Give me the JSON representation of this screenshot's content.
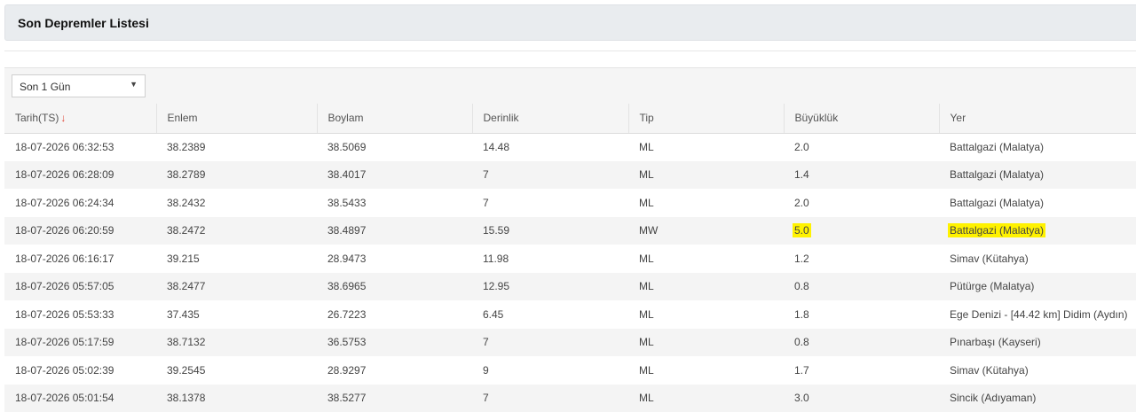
{
  "page": {
    "title": "Son Depremler Listesi"
  },
  "filter": {
    "selected": "Son 1 Gün",
    "arrow": "▼"
  },
  "table": {
    "columns": [
      "Tarih(TS)",
      "Enlem",
      "Boylam",
      "Derinlik",
      "Tip",
      "Büyüklük",
      "Yer"
    ],
    "sort_arrow": "↓",
    "highlight_color": "#fff200",
    "rows": [
      {
        "date": "18-07-2026 06:32:53",
        "lat": "38.2389",
        "lon": "38.5069",
        "depth": "14.48",
        "type": "ML",
        "mag": "2.0",
        "place": "Battalgazi (Malatya)",
        "highlighted": false
      },
      {
        "date": "18-07-2026 06:28:09",
        "lat": "38.2789",
        "lon": "38.4017",
        "depth": "7",
        "type": "ML",
        "mag": "1.4",
        "place": "Battalgazi (Malatya)",
        "highlighted": false
      },
      {
        "date": "18-07-2026 06:24:34",
        "lat": "38.2432",
        "lon": "38.5433",
        "depth": "7",
        "type": "ML",
        "mag": "2.0",
        "place": "Battalgazi (Malatya)",
        "highlighted": false
      },
      {
        "date": "18-07-2026 06:20:59",
        "lat": "38.2472",
        "lon": "38.4897",
        "depth": "15.59",
        "type": "MW",
        "mag": "5.0",
        "place": "Battalgazi (Malatya)",
        "highlighted": true
      },
      {
        "date": "18-07-2026 06:16:17",
        "lat": "39.215",
        "lon": "28.9473",
        "depth": "11.98",
        "type": "ML",
        "mag": "1.2",
        "place": "Simav (Kütahya)",
        "highlighted": false
      },
      {
        "date": "18-07-2026 05:57:05",
        "lat": "38.2477",
        "lon": "38.6965",
        "depth": "12.95",
        "type": "ML",
        "mag": "0.8",
        "place": "Pütürge (Malatya)",
        "highlighted": false
      },
      {
        "date": "18-07-2026 05:53:33",
        "lat": "37.435",
        "lon": "26.7223",
        "depth": "6.45",
        "type": "ML",
        "mag": "1.8",
        "place": "Ege Denizi - [44.42 km] Didim (Aydın)",
        "highlighted": false
      },
      {
        "date": "18-07-2026 05:17:59",
        "lat": "38.7132",
        "lon": "36.5753",
        "depth": "7",
        "type": "ML",
        "mag": "0.8",
        "place": "Pınarbaşı (Kayseri)",
        "highlighted": false
      },
      {
        "date": "18-07-2026 05:02:39",
        "lat": "39.2545",
        "lon": "28.9297",
        "depth": "9",
        "type": "ML",
        "mag": "1.7",
        "place": "Simav (Kütahya)",
        "highlighted": false
      },
      {
        "date": "18-07-2026 05:01:54",
        "lat": "38.1378",
        "lon": "38.5277",
        "depth": "7",
        "type": "ML",
        "mag": "3.0",
        "place": "Sincik (Adıyaman)",
        "highlighted": false
      }
    ]
  }
}
